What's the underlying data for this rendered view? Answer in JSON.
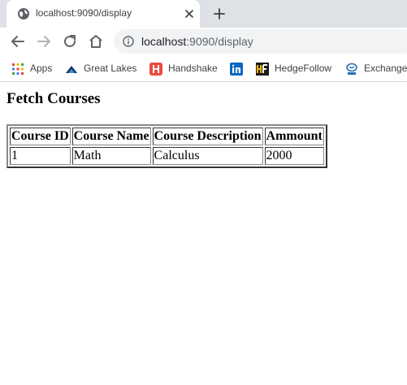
{
  "browser": {
    "tab": {
      "title": "localhost:9090/display"
    },
    "address_bar": {
      "host": "localhost",
      "rest": ":9090/display"
    },
    "bookmarks": [
      {
        "label": "Apps",
        "icon": "apps-grid-icon"
      },
      {
        "label": "Great Lakes",
        "icon": "great-lakes-icon"
      },
      {
        "label": "Handshake",
        "icon": "handshake-icon"
      },
      {
        "label": "",
        "icon": "linkedin-icon"
      },
      {
        "label": "HedgeFollow",
        "icon": "hedgefollow-icon"
      },
      {
        "label": "Exchange_",
        "icon": "tata-icon"
      }
    ]
  },
  "page": {
    "heading": "Fetch Courses",
    "table": {
      "headers": [
        "Course ID",
        "Course Name",
        "Course Description",
        "Ammount"
      ],
      "rows": [
        [
          "1",
          "Math",
          "Calculus",
          "2000"
        ]
      ]
    }
  },
  "colors": {
    "tabstrip": "#dee1e6",
    "omnibox": "#f1f3f4",
    "icon": "#5f6368"
  }
}
